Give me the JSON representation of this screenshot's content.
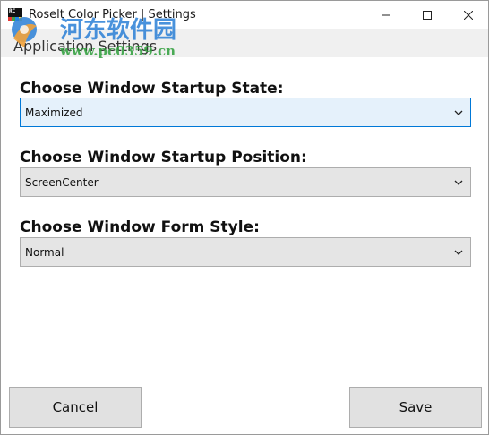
{
  "window": {
    "title": "Roselt Color Picker | Settings",
    "app_icon_text": "RC"
  },
  "title_controls": {
    "minimize_icon": "minimize-icon",
    "maximize_icon": "maximize-icon",
    "close_icon": "close-icon"
  },
  "header": {
    "title": "Application Settings"
  },
  "watermark": {
    "brand": "河东软件园",
    "url": "www.pc0359.cn"
  },
  "settings": [
    {
      "label": "Choose Window Startup State:",
      "value": "Maximized"
    },
    {
      "label": "Choose Window Startup Position:",
      "value": "ScreenCenter"
    },
    {
      "label": "Choose Window Form Style:",
      "value": "Normal"
    }
  ],
  "buttons": {
    "cancel": "Cancel",
    "save": "Save"
  },
  "colors": {
    "focused_border": "#0078d7",
    "focused_background": "#e5f1fb",
    "combo_background": "#e5e5e5",
    "watermark_blue": "#2a7fd6",
    "watermark_green": "#2e9e3a"
  }
}
